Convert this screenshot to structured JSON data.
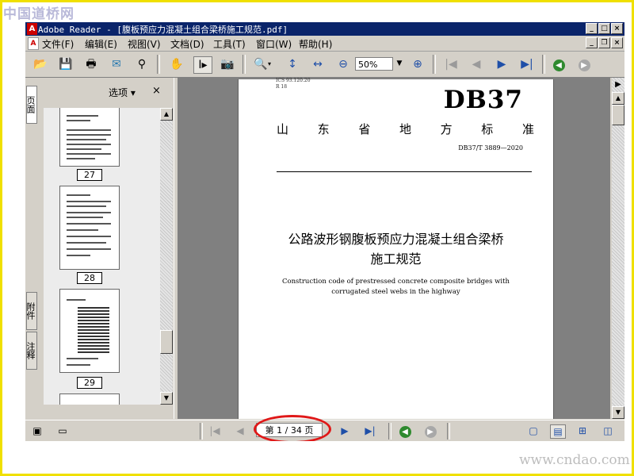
{
  "watermark": {
    "top": "中国道桥网",
    "bottom": "www.cndao.com"
  },
  "window": {
    "title": "Adobe Reader - [腹板预应力混凝土组合梁桥施工规范.pdf]",
    "controls": {
      "minimize": "_",
      "maximize": "□",
      "close": "×"
    }
  },
  "menu": {
    "items": [
      "文件(F)",
      "编辑(E)",
      "视图(V)",
      "文档(D)",
      "工具(T)",
      "窗口(W)",
      "帮助(H)"
    ],
    "doc_controls": {
      "minimize": "_",
      "restore": "❐",
      "close": "×"
    }
  },
  "toolbar": {
    "zoom": "50%"
  },
  "nav_tabs": {
    "pages": "页面",
    "attachments": "附件",
    "comments": "注释"
  },
  "panel": {
    "options_label": "选项 ▾",
    "close": "×",
    "thumbnails": [
      {
        "label": "27"
      },
      {
        "label": "28"
      },
      {
        "label": "29"
      }
    ]
  },
  "page": {
    "ics": "ICS 93.120.20",
    "ccs": "R 18",
    "db_code": "DB37",
    "standard_chars": [
      "山",
      "东",
      "省",
      "地",
      "方",
      "标",
      "准"
    ],
    "standard_number": "DB37/T 3889—2020",
    "title_line1": "公路波形钢腹板预应力混凝土组合梁桥",
    "title_line2": "施工规范",
    "english_title": "Construction code of prestressed concrete composite bridges with corrugated steel webs in the highway"
  },
  "status": {
    "page_indicator": "第 1 / 34 页"
  },
  "colors": {
    "title_bar": "#0a246a",
    "highlight_ellipse": "#e01818",
    "frame": "#f0e000"
  }
}
